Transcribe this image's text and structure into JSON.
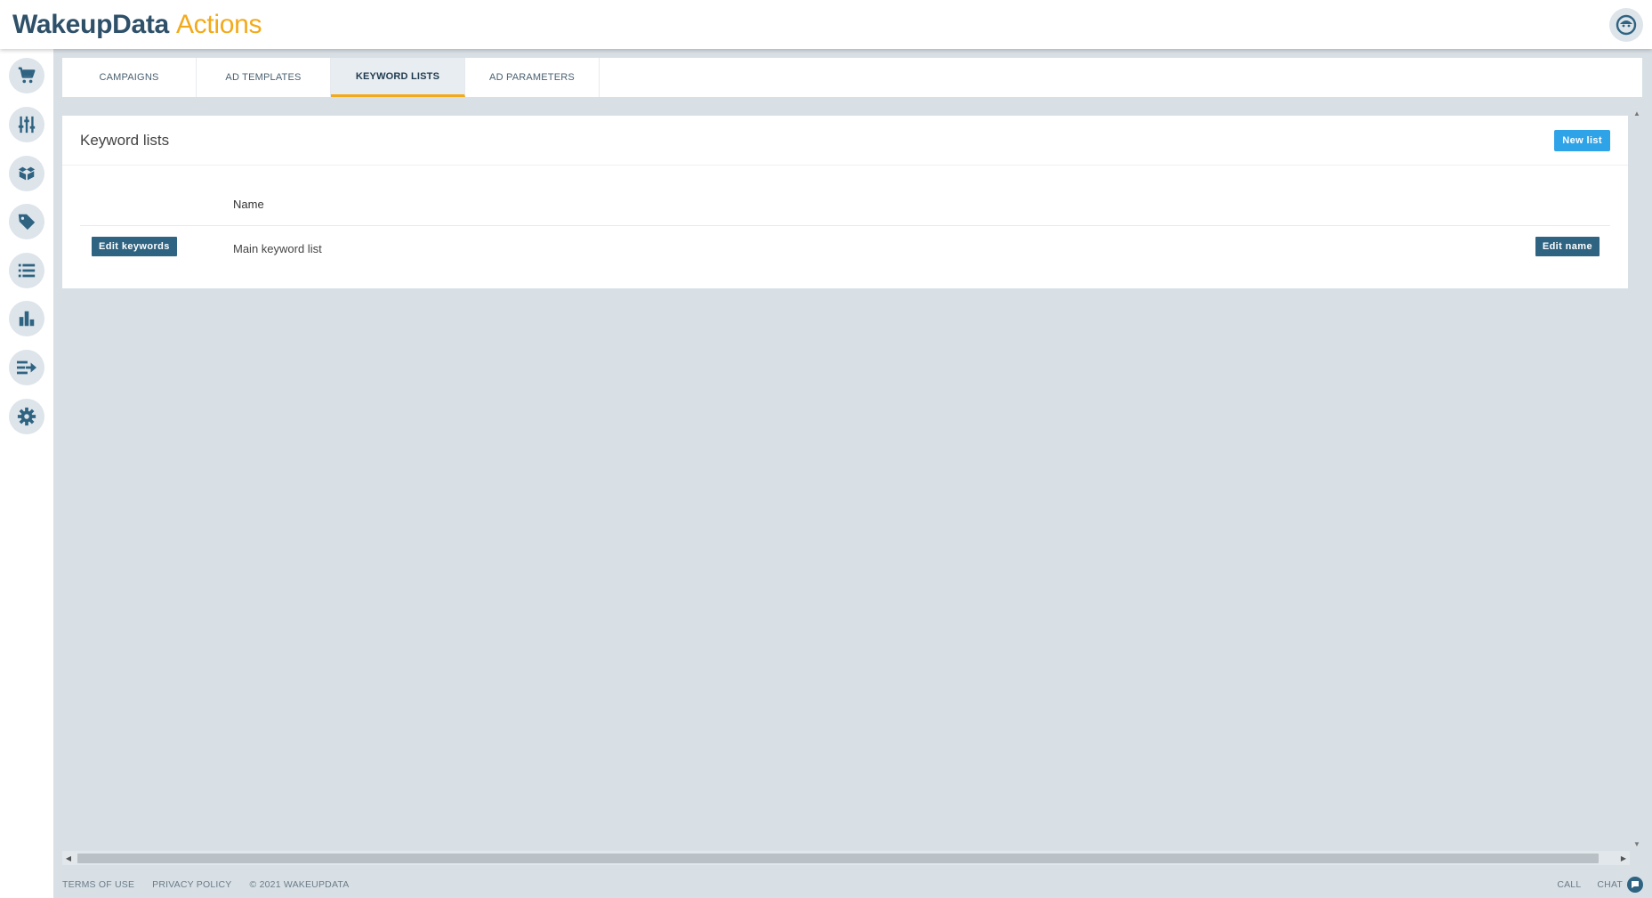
{
  "app": {
    "brand": "WakeupData",
    "product": "Actions"
  },
  "sidebar": {
    "items": [
      {
        "name": "cart-icon"
      },
      {
        "name": "sliders-icon"
      },
      {
        "name": "boxes-icon"
      },
      {
        "name": "tag-icon"
      },
      {
        "name": "list-icon"
      },
      {
        "name": "bar-chart-icon"
      },
      {
        "name": "export-icon"
      },
      {
        "name": "gear-icon"
      }
    ]
  },
  "tabs": [
    {
      "label": "CAMPAIGNS",
      "active": false
    },
    {
      "label": "AD TEMPLATES",
      "active": false
    },
    {
      "label": "KEYWORD LISTS",
      "active": true
    },
    {
      "label": "AD PARAMETERS",
      "active": false
    }
  ],
  "panel": {
    "title": "Keyword lists",
    "new_button": "New list",
    "table": {
      "columns": [
        "Name"
      ],
      "rows": [
        {
          "edit_keywords": "Edit keywords",
          "name": "Main keyword list",
          "edit_name": "Edit name"
        }
      ]
    }
  },
  "footer": {
    "terms": "TERMS OF USE",
    "privacy": "PRIVACY POLICY",
    "copyright": "© 2021 WAKEUPDATA",
    "call": "CALL",
    "chat": "CHAT"
  },
  "colors": {
    "brand": "#2e5068",
    "accent": "#f2aa1b",
    "primary_button": "#2fa3e8",
    "dark_button": "#2e6381",
    "background": "#d8e0e6"
  }
}
